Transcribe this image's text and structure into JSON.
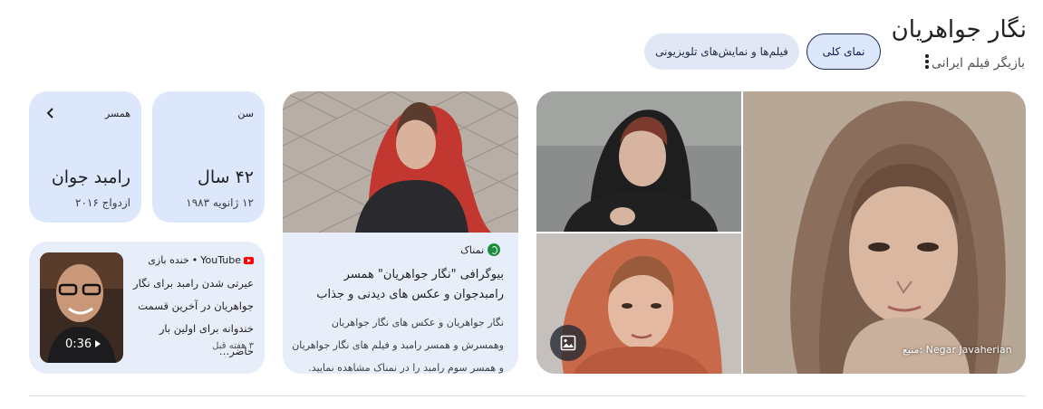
{
  "entity": {
    "name": "نگار جواهریان",
    "subtitle": "بازیگر فیلم ایرانی",
    "more_icon": "more-vert-icon"
  },
  "chips": {
    "overview": "نمای کلی",
    "films": "فیلم‌ها و نمایش‌های تلویزیونی"
  },
  "images": {
    "source_caption": "منبع: Negar Javaherian",
    "more_images_icon": "image-icon"
  },
  "article": {
    "source": "نمناک",
    "source_icon": "site-logo-icon",
    "title": "بیوگرافی \"نگار جواهریان\" همسر رامبدجوان و عکس های دیدنی و جذاب",
    "snippet": "نگار جواهریان و عکس های نگار جواهریان وهمسرش و همسر رامبد و فیلم های نگار جواهریان و همسر سوم رامبد را در نمناک مشاهده نمایید."
  },
  "facts": {
    "age": {
      "label": "سن",
      "value": "۴۲ سال",
      "sub": "۱۲ ژانویه ۱۹۸۳"
    },
    "spouse": {
      "label": "همسر",
      "value": "رامبد جوان",
      "sub": "ازدواج ۲۰۱۶",
      "chevron_icon": "chevron-left-icon"
    }
  },
  "video": {
    "platform": "YouTube",
    "channel": "خنده بازی",
    "platform_icon": "youtube-icon",
    "title": "عیرتی شدن رامبد برای نگار جواهریان در آخرین قسمت خندوانه برای اولین بار حاضر…",
    "age": "۳ هفته قبل",
    "duration": "0:36",
    "play_icon": "play-icon"
  },
  "colors": {
    "card_bg": "#dce7fb",
    "article_bg": "#e8edfa",
    "chip_border": "#1f2f52",
    "youtube_red": "#ff0000",
    "site_green": "#1e8e3e"
  }
}
